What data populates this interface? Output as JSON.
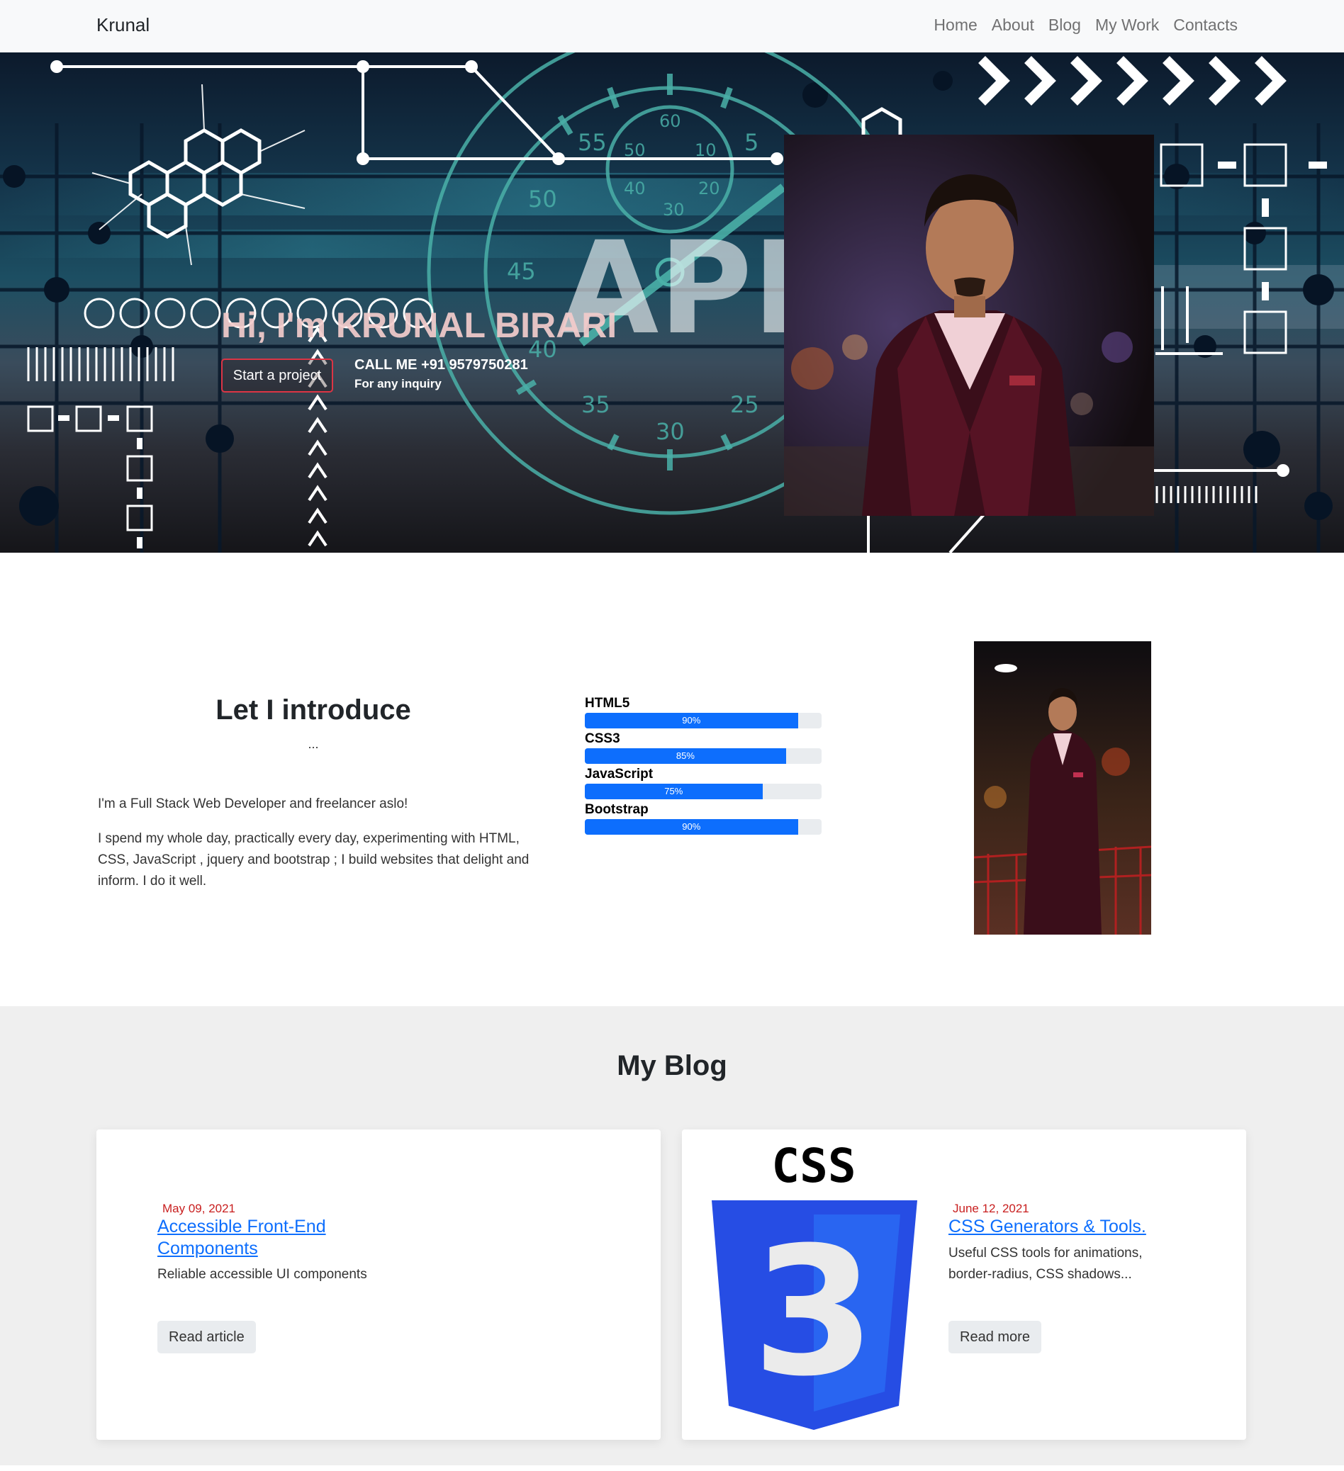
{
  "navbar": {
    "brand": "Krunal",
    "links": [
      "Home",
      "About",
      "Blog",
      "My Work",
      "Contacts"
    ]
  },
  "hero": {
    "background_text": "API",
    "dial_numbers": [
      "60",
      "55",
      "50",
      "45",
      "40",
      "35",
      "30",
      "25",
      "5",
      "50",
      "10",
      "40",
      "20",
      "30"
    ],
    "title": "Hi, I'm KRUNAL BIRARI",
    "button_label": "Start a project",
    "call_text": "CALL ME +91 9579750281",
    "inquiry_text": "For any inquiry"
  },
  "about": {
    "title": "Let I introduce",
    "dots": "...",
    "paragraph1": "I'm a Full Stack Web Developer and freelancer aslo!",
    "paragraph2": "I spend my whole day, practically every day, experimenting with HTML, CSS, JavaScript , jquery and bootstrap ; I build websites that delight and inform. I do it well.",
    "skills": [
      {
        "name": "HTML5",
        "label": "90%",
        "percent": 90
      },
      {
        "name": "CSS3",
        "label": "85%",
        "percent": 85
      },
      {
        "name": "JavaScript",
        "label": "75%",
        "percent": 75
      },
      {
        "name": "Bootstrap",
        "label": "90%",
        "percent": 90
      }
    ]
  },
  "blog": {
    "title": "My Blog",
    "cards": [
      {
        "date": "May 09, 2021",
        "title": "Accessible Front-End Components",
        "description": "Reliable accessible UI components",
        "button": "Read article"
      },
      {
        "date": "June 12, 2021",
        "title": "CSS Generators & Tools.",
        "description": "Useful CSS tools for animations, border-radius, CSS shadows...",
        "button": "Read more",
        "logo_text": "CSS",
        "logo_number": "3"
      }
    ]
  },
  "colors": {
    "accent": "#0d6efd",
    "date_red": "#c81e1e",
    "button_border": "#dc3545",
    "navbar_bg": "#f8f9fa",
    "blog_bg": "#efefef"
  }
}
